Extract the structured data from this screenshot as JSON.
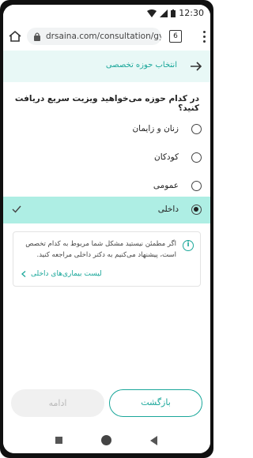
{
  "status_bar": {
    "time": "12:30"
  },
  "browser": {
    "url": "drsaina.com/consultation/gy",
    "tab_count": "6"
  },
  "header": {
    "title": "انتخاب حوزه تخصصی"
  },
  "question": "در کدام حوزه می‌خواهید ویزیت سریع دریافت کنید؟",
  "options": [
    {
      "label": "زنان و زایمان",
      "selected": false
    },
    {
      "label": "کودکان",
      "selected": false
    },
    {
      "label": "عمومی",
      "selected": false
    },
    {
      "label": "داخلی",
      "selected": true
    }
  ],
  "info": {
    "text": "اگر مطمئن نیستید مشکل شما مربوط به کدام تخصص است، پیشنهاد می‌کنیم به دکتر داخلی مراجعه کنید.",
    "link": "لیست بیماری‌های داخلی"
  },
  "buttons": {
    "back": "بازگشت",
    "next": "ادامه"
  },
  "colors": {
    "accent": "#1aa79a",
    "selected_bg": "#aeeee4",
    "header_bg": "#e8f8f6"
  }
}
